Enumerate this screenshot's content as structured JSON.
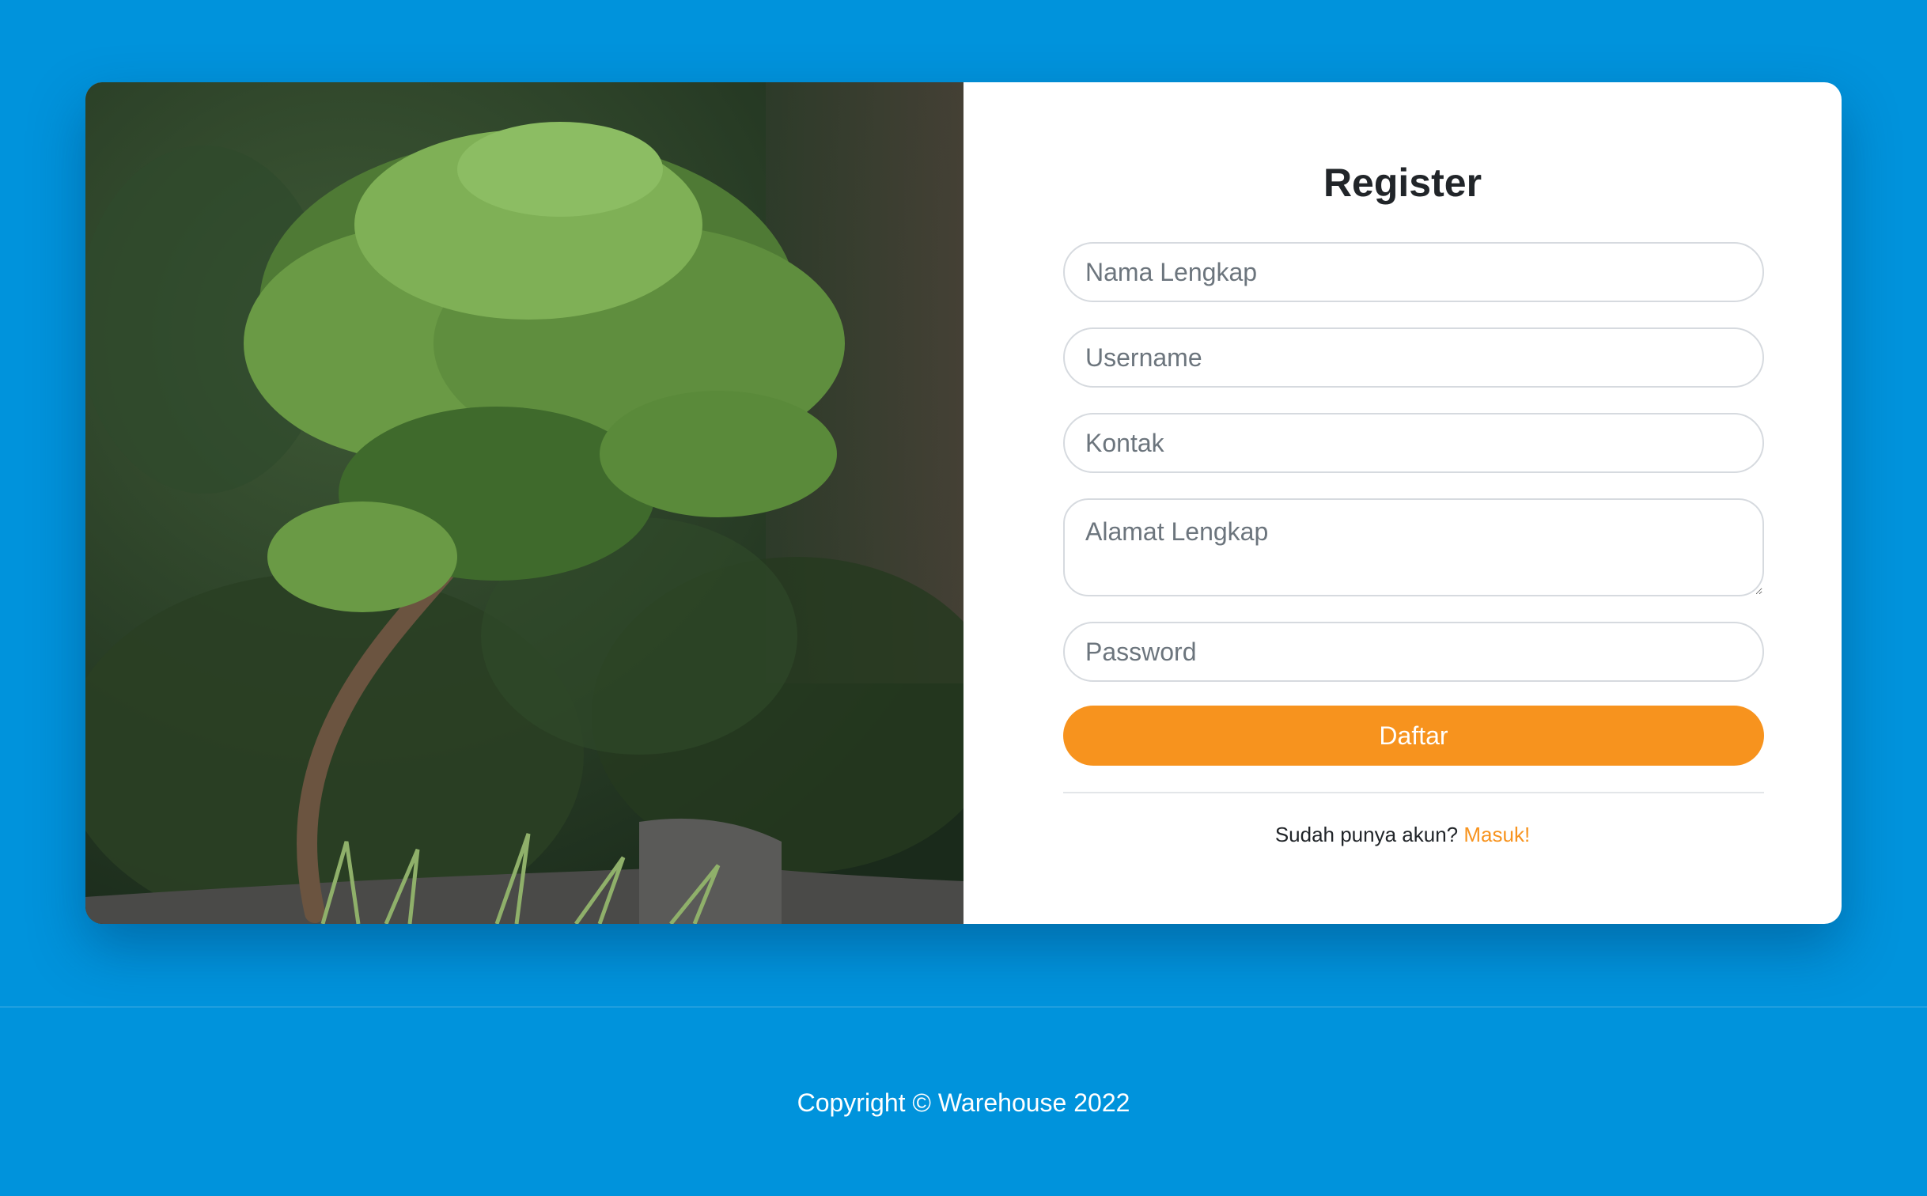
{
  "register": {
    "title": "Register",
    "full_name_placeholder": "Nama Lengkap",
    "username_placeholder": "Username",
    "contact_placeholder": "Kontak",
    "address_placeholder": "Alamat Lengkap",
    "password_placeholder": "Password",
    "submit_label": "Daftar",
    "have_account_text": "Sudah punya akun?",
    "login_link": "Masuk!"
  },
  "footer": {
    "copyright": "Copyright © Warehouse 2022"
  },
  "colors": {
    "background": "#0093dc",
    "accent": "#f7931e",
    "card": "#ffffff"
  },
  "hero_image": {
    "subject": "bonsai-tree-photo"
  }
}
